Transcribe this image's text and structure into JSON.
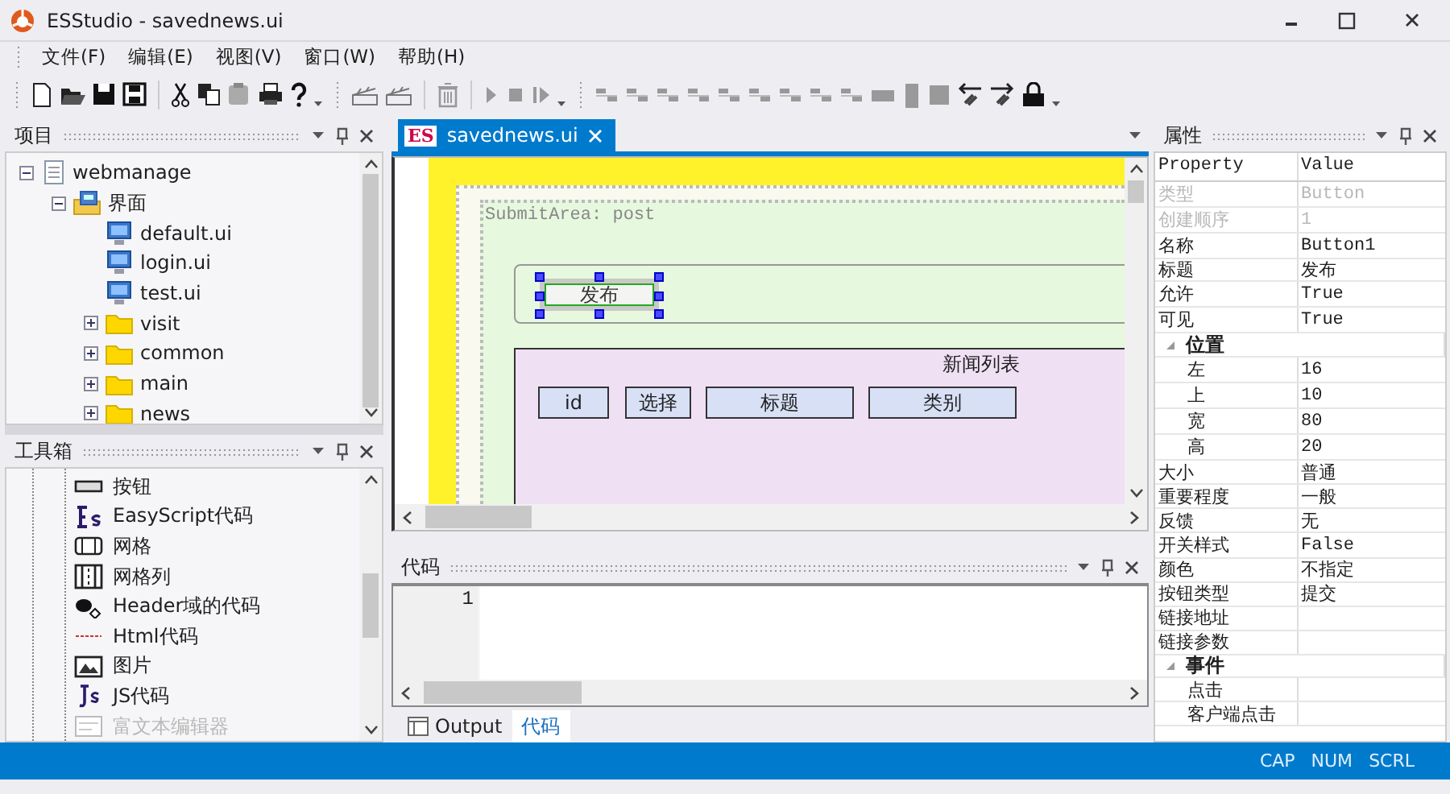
{
  "window": {
    "title": "ESStudio - savednews.ui"
  },
  "menu": [
    "文件(F)",
    "编辑(E)",
    "视图(V)",
    "窗口(W)",
    "帮助(H)"
  ],
  "project_panel": {
    "title": "项目",
    "tree": [
      {
        "label": "webmanage",
        "kind": "project",
        "expanded": true,
        "children": [
          {
            "label": "界面",
            "kind": "form-folder",
            "expanded": true,
            "children": [
              {
                "label": "default.ui",
                "kind": "form"
              },
              {
                "label": "login.ui",
                "kind": "form"
              },
              {
                "label": "test.ui",
                "kind": "form"
              },
              {
                "label": "visit",
                "kind": "folder",
                "expanded": false
              },
              {
                "label": "common",
                "kind": "folder",
                "expanded": false
              },
              {
                "label": "main",
                "kind": "folder",
                "expanded": false
              },
              {
                "label": "news",
                "kind": "folder",
                "expanded": false
              }
            ]
          }
        ]
      }
    ]
  },
  "toolbox_panel": {
    "title": "工具箱",
    "items": [
      {
        "label": "按钮",
        "kind": "button"
      },
      {
        "label": "EasyScript代码",
        "kind": "script"
      },
      {
        "label": "网格",
        "kind": "grid"
      },
      {
        "label": "网格列",
        "kind": "grid-column"
      },
      {
        "label": "Header域的代码",
        "kind": "header"
      },
      {
        "label": "Html代码",
        "kind": "html"
      },
      {
        "label": "图片",
        "kind": "image"
      },
      {
        "label": "JS代码",
        "kind": "js"
      },
      {
        "label": "富文本编辑器",
        "kind": "rich-text"
      }
    ]
  },
  "document_tabs": [
    {
      "badge": "ES",
      "label": "savednews.ui",
      "selected": true
    }
  ],
  "designer": {
    "submit_area": "SubmitArea: post",
    "button": {
      "label": "发布",
      "selected": true
    },
    "grid": {
      "title": "新闻列表",
      "columns": [
        "id",
        "选择",
        "标题",
        "类别"
      ]
    }
  },
  "code_panel": {
    "title": "代码",
    "line_numbers": [
      "1"
    ]
  },
  "bottom_tabs": [
    {
      "label": "Output",
      "selected": false
    },
    {
      "label": "代码",
      "selected": true
    }
  ],
  "properties_panel": {
    "title": "属性",
    "columns": [
      "Property",
      "Value"
    ],
    "rows": [
      {
        "kind": "property",
        "name": "类型",
        "value": "Button",
        "disabled": true
      },
      {
        "kind": "property",
        "name": "创建顺序",
        "value": "1",
        "disabled": true
      },
      {
        "kind": "property",
        "name": "名称",
        "value": "Button1",
        "disabled": false
      },
      {
        "kind": "property",
        "name": "标题",
        "value": "发布",
        "disabled": false
      },
      {
        "kind": "property",
        "name": "允许",
        "value": "True",
        "disabled": false
      },
      {
        "kind": "property",
        "name": "可见",
        "value": "True",
        "disabled": false
      },
      {
        "kind": "category",
        "name": "位置",
        "expanded": true,
        "children": [
          {
            "kind": "property",
            "name": "左",
            "value": "16",
            "disabled": false
          },
          {
            "kind": "property",
            "name": "上",
            "value": "10",
            "disabled": false
          },
          {
            "kind": "property",
            "name": "宽",
            "value": "80",
            "disabled": false
          },
          {
            "kind": "property",
            "name": "高",
            "value": "20",
            "disabled": false
          }
        ]
      },
      {
        "kind": "property",
        "name": "大小",
        "value": "普通",
        "disabled": false
      },
      {
        "kind": "property",
        "name": "重要程度",
        "value": "一般",
        "disabled": false
      },
      {
        "kind": "property",
        "name": "反馈",
        "value": "无",
        "disabled": false
      },
      {
        "kind": "property",
        "name": "开关样式",
        "value": "False",
        "disabled": false
      },
      {
        "kind": "property",
        "name": "颜色",
        "value": "不指定",
        "disabled": false
      },
      {
        "kind": "property",
        "name": "按钮类型",
        "value": "提交",
        "disabled": false
      },
      {
        "kind": "property",
        "name": "链接地址",
        "disabled": false
      },
      {
        "kind": "property",
        "name": "链接参数",
        "disabled": false
      },
      {
        "kind": "category",
        "name": "事件",
        "expanded": true,
        "children": [
          {
            "kind": "property",
            "name": "点击",
            "disabled": false
          },
          {
            "kind": "property",
            "name": "客户端点击",
            "disabled": false
          }
        ]
      }
    ]
  },
  "status_bar": [
    "CAP",
    "NUM",
    "SCRL"
  ]
}
